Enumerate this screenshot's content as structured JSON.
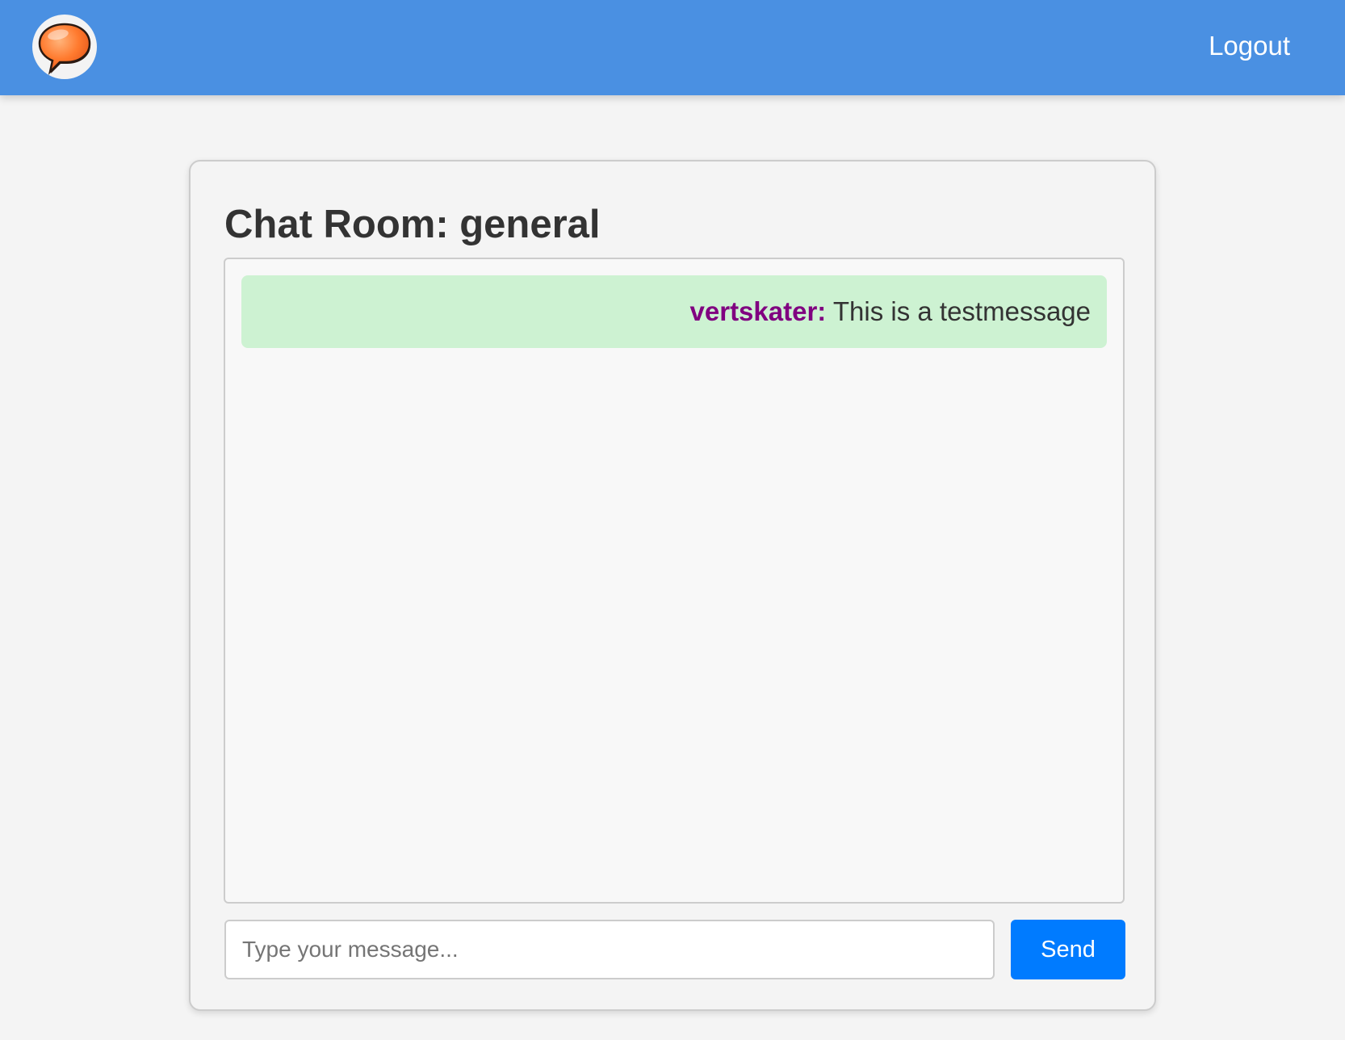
{
  "header": {
    "logo_icon": "speech-bubble-icon",
    "logout_label": "Logout",
    "background_color": "#4a90e2"
  },
  "chat": {
    "title": "Chat Room: general",
    "messages": [
      {
        "username": "vertskater:",
        "text": "This is a testmessage",
        "username_color": "#800080",
        "background_color": "#cdf2d2"
      }
    ],
    "input": {
      "placeholder": "Type your message...",
      "value": ""
    },
    "send_label": "Send",
    "send_color": "#007bff"
  }
}
